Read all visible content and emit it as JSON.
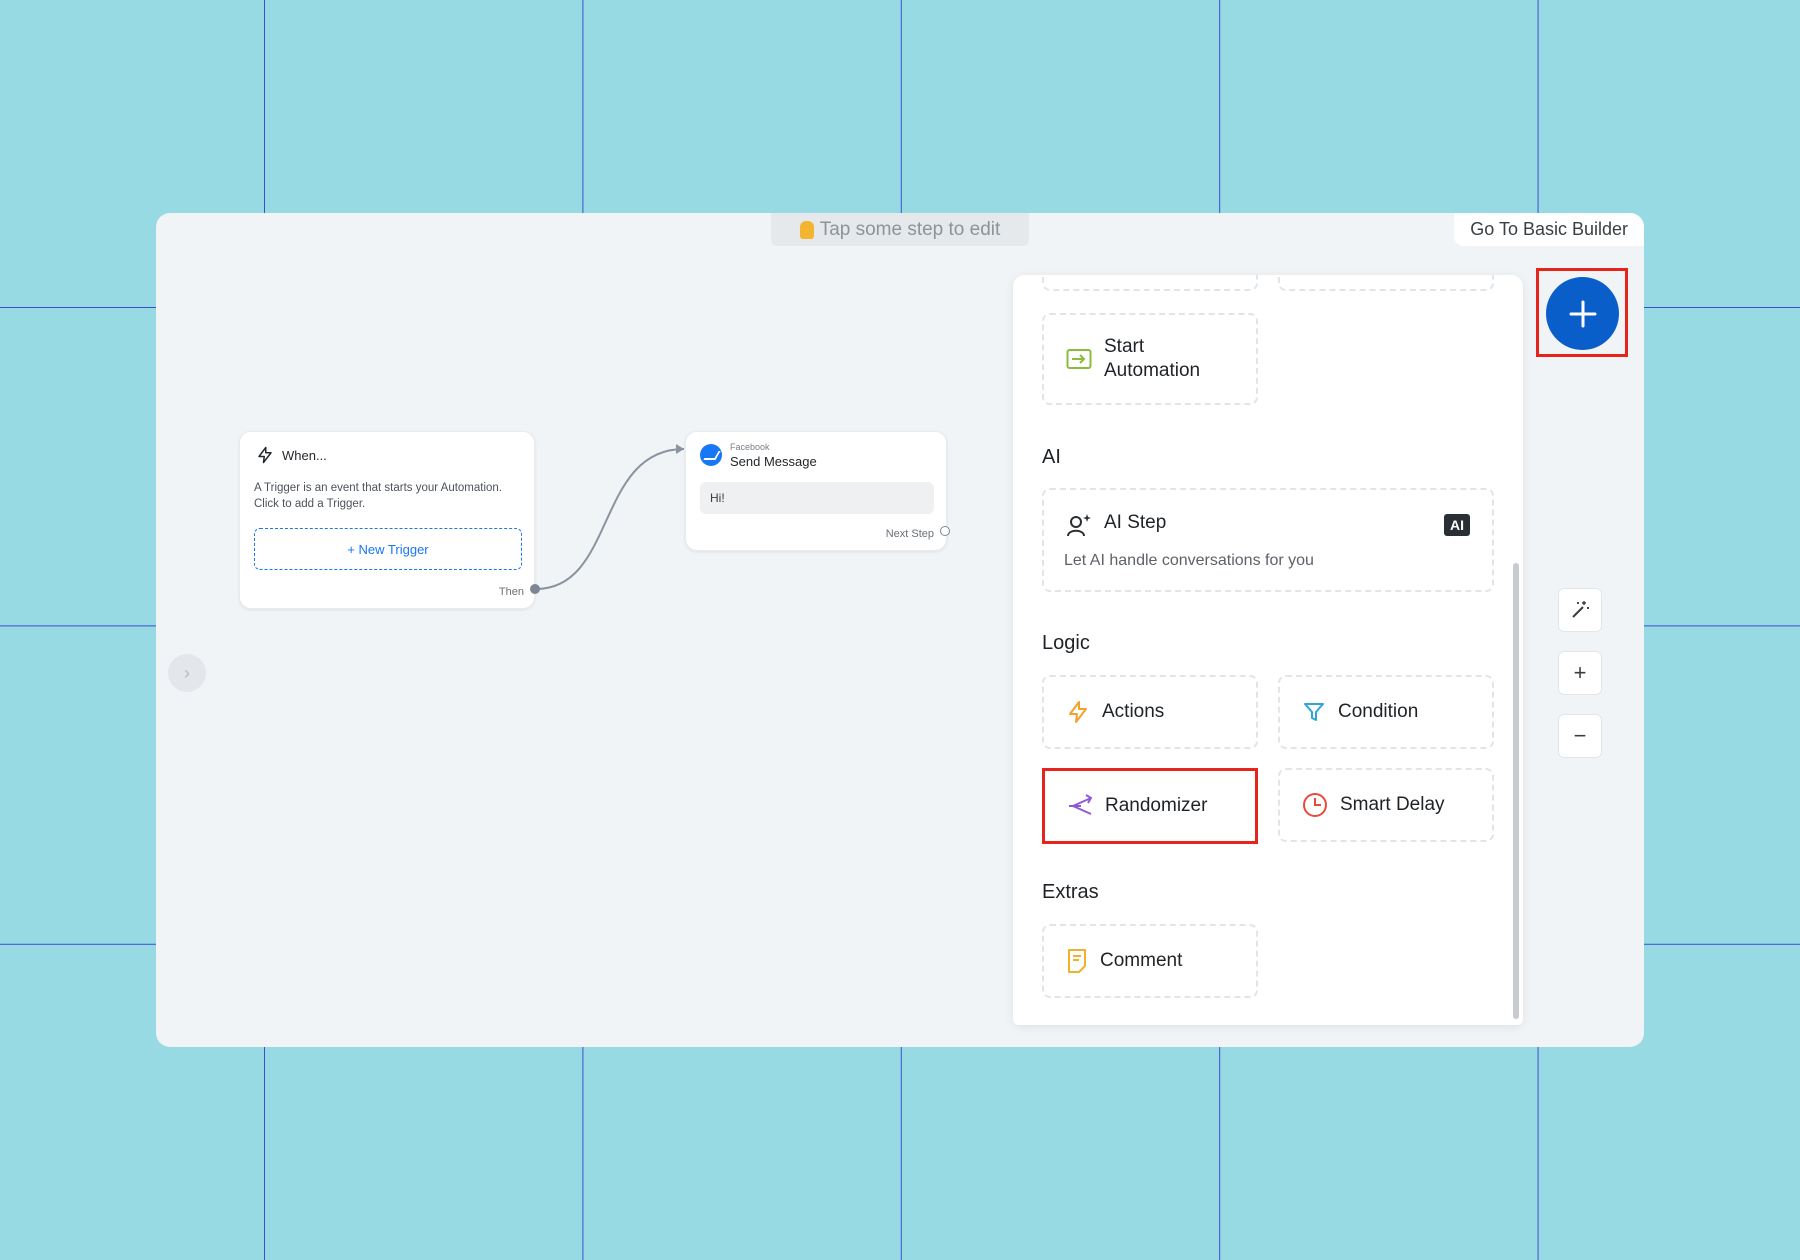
{
  "header": {
    "hint": "Tap some step to edit",
    "basic_builder": "Go To Basic Builder"
  },
  "trigger_node": {
    "title": "When...",
    "description": "A Trigger is an event that starts your Automation. Click to add a Trigger.",
    "new_trigger_label": "+ New Trigger",
    "then_label": "Then"
  },
  "send_node": {
    "platform": "Facebook",
    "title": "Send Message",
    "message": "Hi!",
    "next_label": "Next Step"
  },
  "panel": {
    "start_automation": "Start\nAutomation",
    "ai_section": "AI",
    "ai_step": {
      "label": "AI Step",
      "badge": "AI",
      "subtitle": "Let AI handle conversations for you"
    },
    "logic_section": "Logic",
    "logic_items": [
      "Actions",
      "Condition",
      "Randomizer",
      "Smart Delay"
    ],
    "extras_section": "Extras",
    "extras_items": [
      "Comment"
    ]
  },
  "colors": {
    "background": "#98dae3",
    "grid_line": "#3b4fd0",
    "accent": "#0a5ec9",
    "highlight": "#e6241b"
  },
  "icons": [
    "hand-pointing-down-icon",
    "chevron-right-icon",
    "lightning-icon",
    "messenger-icon",
    "start-automation-icon",
    "ai-person-icon",
    "actions-lightning-icon",
    "filter-icon",
    "randomizer-icon",
    "clock-icon",
    "comment-icon",
    "plus-icon",
    "magic-wand-icon",
    "zoom-in-icon",
    "zoom-out-icon"
  ]
}
